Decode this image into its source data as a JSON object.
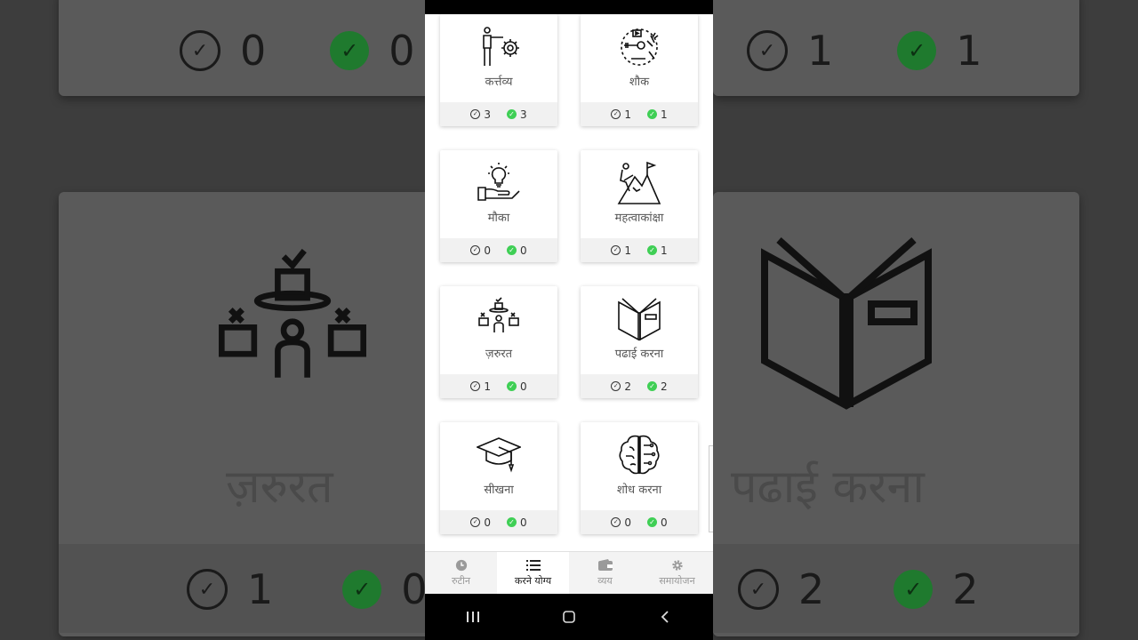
{
  "background": {
    "top_left_stats": {
      "todo": "0",
      "done": "0"
    },
    "top_right_stats": {
      "todo": "1",
      "done": "1"
    },
    "left_label": "ज़रुरत",
    "right_label": "पढाई करना",
    "bottom_left_stats": {
      "todo": "1",
      "done": "0"
    },
    "bottom_right_stats": {
      "todo": "2",
      "done": "2"
    }
  },
  "cards": [
    {
      "title": "कर्त्तव्य",
      "icon": "person-gear-icon",
      "todo": "3",
      "done": "3"
    },
    {
      "title": "शौक",
      "icon": "hobbies-icon",
      "todo": "1",
      "done": "1"
    },
    {
      "title": "मौका",
      "icon": "hand-lightbulb-icon",
      "todo": "0",
      "done": "0"
    },
    {
      "title": "महत्वाकांक्षा",
      "icon": "mountain-flag-icon",
      "todo": "1",
      "done": "1"
    },
    {
      "title": "ज़रुरत",
      "icon": "person-boxes-icon",
      "todo": "1",
      "done": "0"
    },
    {
      "title": "पढाई करना",
      "icon": "open-book-icon",
      "todo": "2",
      "done": "2"
    },
    {
      "title": "सीखना",
      "icon": "graduation-cap-icon",
      "todo": "0",
      "done": "0"
    },
    {
      "title": "शोध करना",
      "icon": "brain-circuit-icon",
      "todo": "0",
      "done": "0"
    }
  ],
  "nav": [
    {
      "label": "रुटीन",
      "icon": "clock-icon",
      "active": false
    },
    {
      "label": "करने योग्य",
      "icon": "list-icon",
      "active": true
    },
    {
      "label": "व्यय",
      "icon": "wallet-icon",
      "active": false
    },
    {
      "label": "समायोजन",
      "icon": "gear-icon",
      "active": false
    }
  ],
  "system_nav": [
    "recent-apps-icon",
    "home-icon",
    "back-icon"
  ]
}
